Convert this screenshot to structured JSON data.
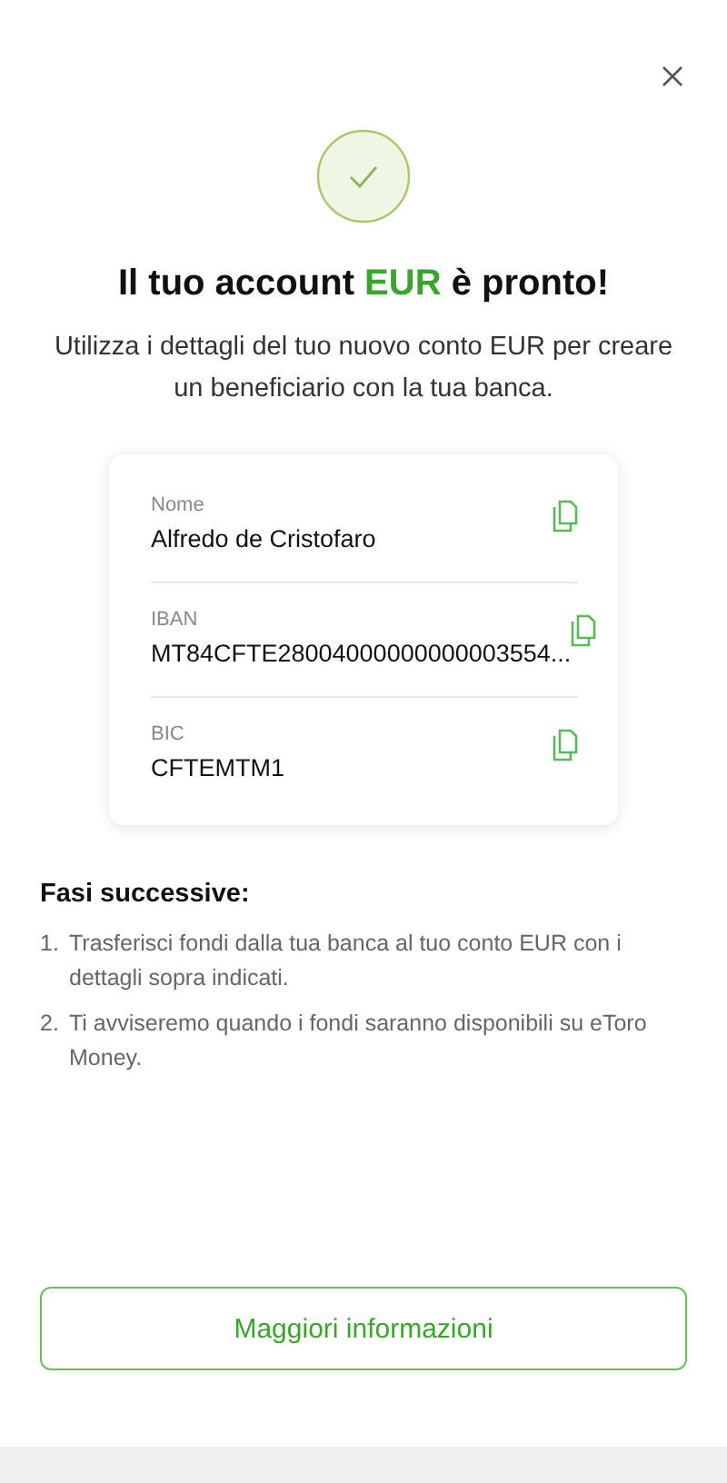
{
  "title": {
    "before": "Il tuo account ",
    "highlight": "EUR",
    "after": " è pronto!"
  },
  "subtitle": "Utilizza i dettagli del tuo nuovo conto EUR per creare un beneficiario con la tua banca.",
  "details": [
    {
      "label": "Nome",
      "value": "Alfredo de Cristofaro"
    },
    {
      "label": "IBAN",
      "value": "MT84CFTE28004000000000003554..."
    },
    {
      "label": "BIC",
      "value": "CFTEMTM1"
    }
  ],
  "next_steps": {
    "heading": "Fasi successive:",
    "items": [
      {
        "number": "1.",
        "text": "Trasferisci fondi dalla tua banca al tuo conto EUR con i dettagli sopra indicati."
      },
      {
        "number": "2.",
        "text": "Ti avviseremo quando i fondi saranno disponibili su eToro Money."
      }
    ]
  },
  "button": "Maggiori informazioni"
}
